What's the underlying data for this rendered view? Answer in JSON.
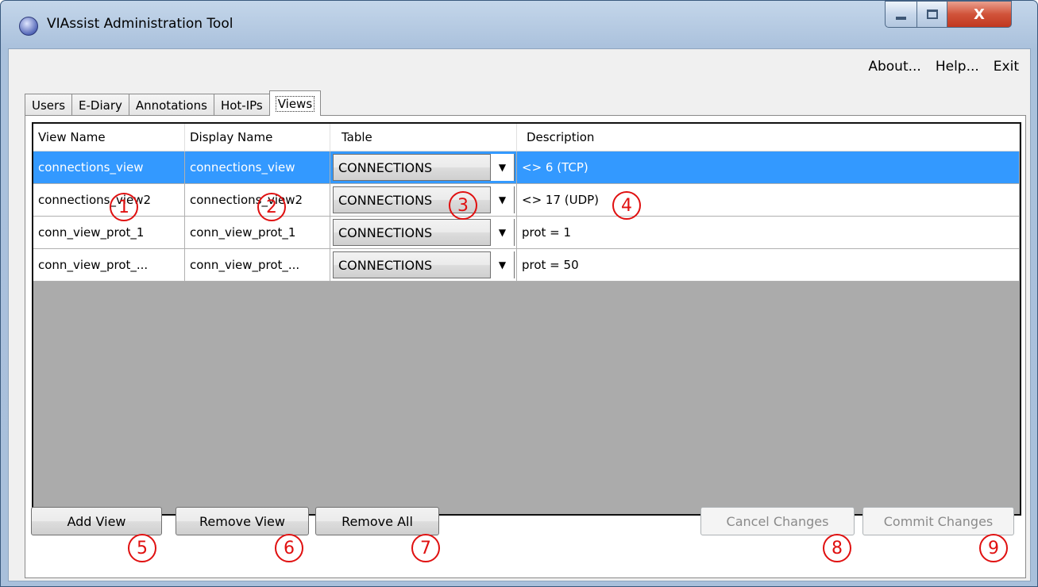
{
  "window": {
    "title": "VIAssist Administration Tool",
    "close_glyph": "X"
  },
  "menu": [
    {
      "label": "About..."
    },
    {
      "label": "Help..."
    },
    {
      "label": "Exit"
    }
  ],
  "tabs": [
    {
      "label": "Users"
    },
    {
      "label": "E-Diary"
    },
    {
      "label": "Annotations"
    },
    {
      "label": "Hot-IPs"
    },
    {
      "label": "Views",
      "active": true
    }
  ],
  "grid": {
    "columns": [
      "View Name",
      "Display Name",
      "Table",
      "Description"
    ],
    "rows": [
      {
        "view_name": "connections_view",
        "display_name": "connections_view",
        "table": "CONNECTIONS",
        "description": "<> 6 (TCP)",
        "selected": true
      },
      {
        "view_name": "connections_view2",
        "display_name": "connections_view2",
        "table": "CONNECTIONS",
        "description": "<> 17 (UDP)"
      },
      {
        "view_name": "conn_view_prot_1",
        "display_name": "conn_view_prot_1",
        "table": "CONNECTIONS",
        "description": "prot = 1"
      },
      {
        "view_name": "conn_view_prot_...",
        "display_name": "conn_view_prot_...",
        "table": "CONNECTIONS",
        "description": "prot = 50"
      }
    ]
  },
  "buttons": {
    "add_view": "Add View",
    "remove_view": "Remove View",
    "remove_all": "Remove All",
    "cancel_changes": "Cancel Changes",
    "commit_changes": "Commit Changes"
  },
  "markers": [
    "1",
    "2",
    "3",
    "4",
    "5",
    "6",
    "7",
    "8",
    "9"
  ],
  "colors": {
    "selection": "#3399ff",
    "marker": "#e01010",
    "grid_background": "#ababab"
  },
  "icons": {
    "app": "viassist-app-icon",
    "dropdown": "dropdown-arrow-icon"
  }
}
